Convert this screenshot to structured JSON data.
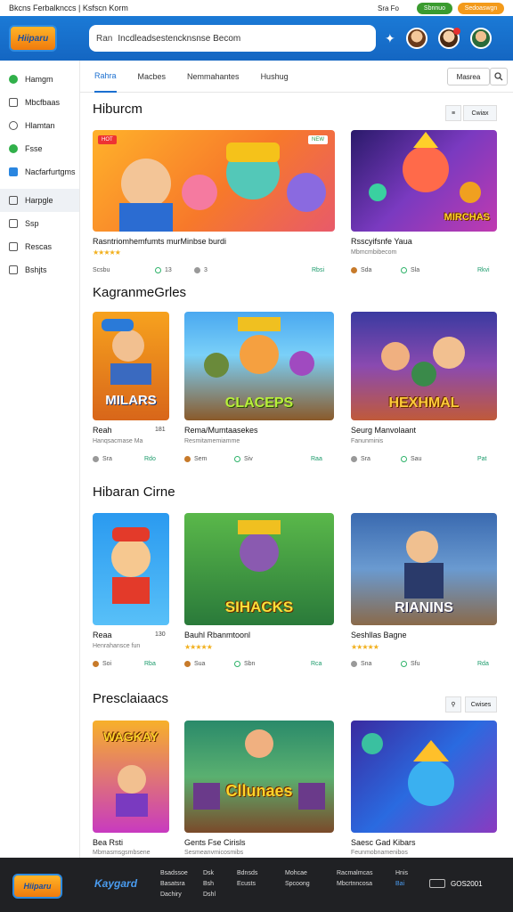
{
  "topbar": {
    "title": "Bkcns Ferbalknccs | Ksfscn Korm",
    "links": "Sra  Fo",
    "signup": "Sbnnuo",
    "login": "Sedoaswgn"
  },
  "header": {
    "logo_text": "Hiiparu",
    "search_prefix": "Ran",
    "search_placeholder": "Incdleadsestencknsnse Becom"
  },
  "sidebar": {
    "items": [
      {
        "label": "Hamgm",
        "icon": "check-icon"
      },
      {
        "label": "Mbcfbaas",
        "icon": "box-icon"
      },
      {
        "label": "Hlamtan",
        "icon": "chat-icon"
      },
      {
        "label": "Fsse",
        "icon": "heart-icon"
      },
      {
        "label": "Nacfarfurtgms",
        "icon": "bookmark-icon"
      },
      {
        "label": "Harpgle",
        "icon": "grid-icon"
      },
      {
        "label": "Ssp",
        "icon": "doc-icon"
      },
      {
        "label": "Rescas",
        "icon": "list-icon"
      },
      {
        "label": "Bshjts",
        "icon": "folder-icon"
      }
    ]
  },
  "tabs": [
    "Rahra",
    "Macbes",
    "Nemmahantes",
    "Hushug"
  ],
  "sort": {
    "label": "Masrea"
  },
  "sections": [
    {
      "title": "Hiburcm",
      "view_btns": [
        "≡",
        "Cwiax"
      ],
      "cards": [
        {
          "name": "Rasntriomhemfumts murMinbse burdi",
          "rating": "★★★★★",
          "meta": "Scsbu",
          "m2": "13",
          "m3": "3",
          "link": "Rbsi",
          "hot": "HOT",
          "new": "NEW"
        },
        {
          "name": "Rsscyifsnfe Yaua",
          "sub": "Mbmcmbibecom",
          "meta": "Sda",
          "m2": "Sla",
          "link": "Rkvi",
          "title": "MIRCHAS"
        }
      ]
    },
    {
      "title": "KagranmeGrles",
      "cards": [
        {
          "name": "Reah",
          "count": "181",
          "sub": "Hanqsacmase Ma",
          "meta": "Sra",
          "m2": "Bdo",
          "link": "Rdo",
          "title": "MILARS"
        },
        {
          "name": "Rema/Mumtaasekes",
          "sub": "Resmitamemiamme",
          "meta": "Sem",
          "m2": "Siv",
          "link": "Raa",
          "title": "CLACEPS"
        },
        {
          "name": "Seurg Manvolaant",
          "sub": "Fanunminis",
          "meta": "Sra",
          "m2": "Sau",
          "link": "Pat",
          "title": "HEXHMAL"
        }
      ]
    },
    {
      "title": "Hibaran Cirne",
      "cards": [
        {
          "name": "Reaa",
          "count": "130",
          "sub": "Henrahansce fun",
          "meta": "Soi",
          "m2": "Sfu",
          "link": "Rba",
          "title": ""
        },
        {
          "name": "Bauhl Rbanmtoonl",
          "rating": "★★★★★",
          "meta": "Sua",
          "m2": "Sbn",
          "link": "Rca",
          "title": "SIHACKS"
        },
        {
          "name": "Seshllas Bagne",
          "rating": "★★★★★",
          "meta": "Sna",
          "m2": "Sfu",
          "link": "Rda",
          "title": "RIANINS"
        }
      ]
    },
    {
      "title": "Presclaiaacs",
      "view_btns": [
        "⚲",
        "Cwises"
      ],
      "cards": [
        {
          "name": "Bea Rsti",
          "sub": "Mbmasmsgsmbsene",
          "title": "WAGKAY"
        },
        {
          "name": "Gents Fse Cirisls",
          "sub": "Sesmeanvmicosmibs",
          "title": "Cllunaes"
        },
        {
          "name": "Saesc Gad Kibars",
          "sub": "Feunmobnamenibos",
          "title": ""
        }
      ]
    }
  ],
  "footer": {
    "logo_text": "Hiiparu",
    "brand": "Kaygard",
    "cols": [
      [
        "Bsadssoe",
        "Basatsra",
        "Dachiry"
      ],
      [
        "Dsk",
        "Bsh",
        "Dshl"
      ],
      [
        "Bdnsds",
        "Ecusts"
      ],
      [
        "Mohcae",
        "Spcoong"
      ],
      [
        "Racmalmcas",
        "Mbcrtnncosa"
      ],
      [
        "Hnis",
        "Bai"
      ]
    ],
    "app": "GOS2001"
  },
  "colors": {
    "primary": "#1a6fd0",
    "header": "#1b7ad6",
    "footer": "#202124",
    "accent_green": "#3a9b2f",
    "accent_orange": "#f39a1a"
  }
}
